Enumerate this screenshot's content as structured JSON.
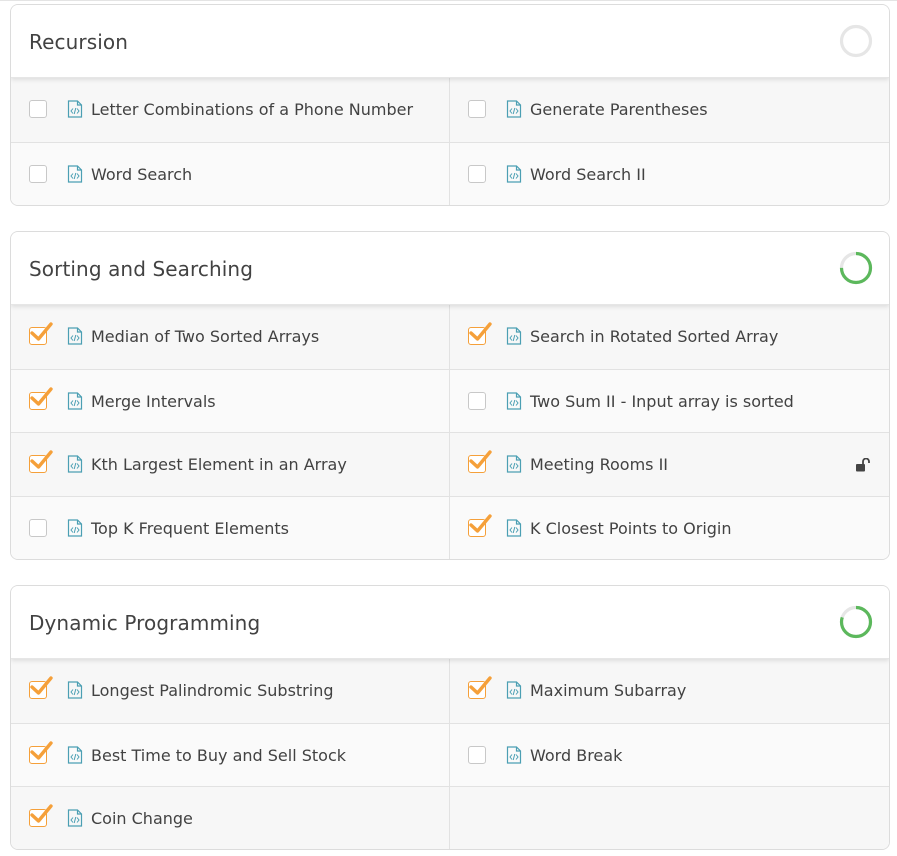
{
  "sections": [
    {
      "title": "Recursion",
      "progress": 0.0,
      "items": [
        {
          "label": "Letter Combinations of a Phone Number",
          "checked": false
        },
        {
          "label": "Generate Parentheses",
          "checked": false
        },
        {
          "label": "Word Search",
          "checked": false
        },
        {
          "label": "Word Search II",
          "checked": false
        }
      ]
    },
    {
      "title": "Sorting and Searching",
      "progress": 0.75,
      "items": [
        {
          "label": "Median of Two Sorted Arrays",
          "checked": true
        },
        {
          "label": "Search in Rotated Sorted Array",
          "checked": true
        },
        {
          "label": "Merge Intervals",
          "checked": true
        },
        {
          "label": "Two Sum II - Input array is sorted",
          "checked": false
        },
        {
          "label": "Kth Largest Element in an Array",
          "checked": true
        },
        {
          "label": "Meeting Rooms II",
          "checked": true,
          "locked": true
        },
        {
          "label": "Top K Frequent Elements",
          "checked": false
        },
        {
          "label": "K Closest Points to Origin",
          "checked": true
        }
      ]
    },
    {
      "title": "Dynamic Programming",
      "progress": 0.8,
      "items": [
        {
          "label": "Longest Palindromic Substring",
          "checked": true
        },
        {
          "label": "Maximum Subarray",
          "checked": true
        },
        {
          "label": "Best Time to Buy and Sell Stock",
          "checked": true
        },
        {
          "label": "Word Break",
          "checked": false
        },
        {
          "label": "Coin Change",
          "checked": true
        }
      ]
    }
  ],
  "icons": {
    "item": "code-file-icon",
    "locked": "unlocked-padlock-icon"
  },
  "colors": {
    "check_accent": "#f5a03a",
    "progress_ring": "#5cb85c",
    "ring_track": "#e6e6e6",
    "file_icon": "#4b9fb3",
    "text": "#424242"
  }
}
